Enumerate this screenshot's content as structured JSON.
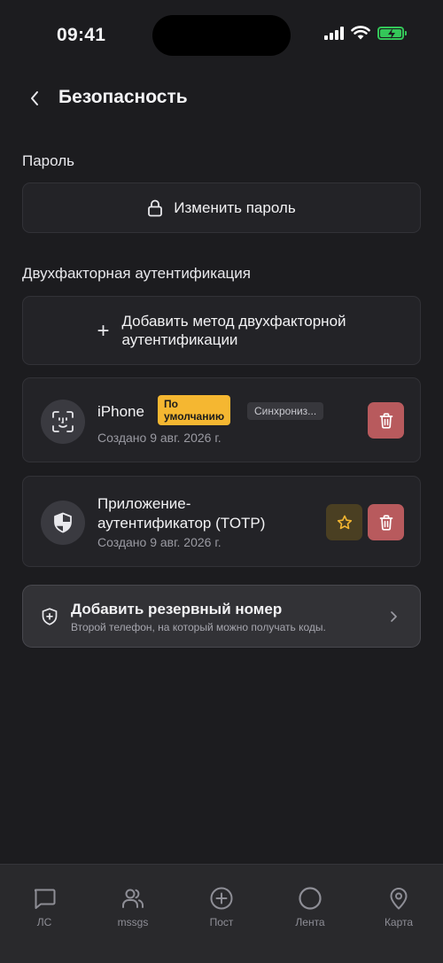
{
  "status": {
    "time": "09:41"
  },
  "header": {
    "title": "Безопасность"
  },
  "password": {
    "section_title": "Пароль",
    "change_label": "Изменить пароль"
  },
  "two_factor": {
    "section_title": "Двухфакторная аутентификация",
    "add_label_line1": "Добавить метод двухфакторной",
    "add_label_line2": "аутентификации",
    "methods": [
      {
        "name": "iPhone",
        "badge_default_line1": "По",
        "badge_default_line2": "умолчанию",
        "badge_sync": "Синхрониз...",
        "created": "Создано 9 авг. 2026 г.",
        "icon": "face-id-icon"
      },
      {
        "name_line1": "Приложение-",
        "name_line2": "аутентификатор (TOTP)",
        "created": "Создано 9 авг. 2026 г.",
        "icon": "shield-icon"
      }
    ]
  },
  "backup": {
    "title": "Добавить резервный номер",
    "subtitle": "Второй телефон, на который можно получать коды."
  },
  "nav": {
    "items": [
      {
        "label": "ЛС",
        "icon": "chat-bubble-icon"
      },
      {
        "label": "mssgs",
        "icon": "users-icon"
      },
      {
        "label": "Пост",
        "icon": "plus-circle-icon"
      },
      {
        "label": "Лента",
        "icon": "circle-icon"
      },
      {
        "label": "Карта",
        "icon": "map-pin-icon"
      }
    ]
  },
  "colors": {
    "background": "#1c1c1f",
    "card": "#232327",
    "badge_default": "#f5b731",
    "delete": "#b85a5d",
    "battery": "#34c759"
  }
}
